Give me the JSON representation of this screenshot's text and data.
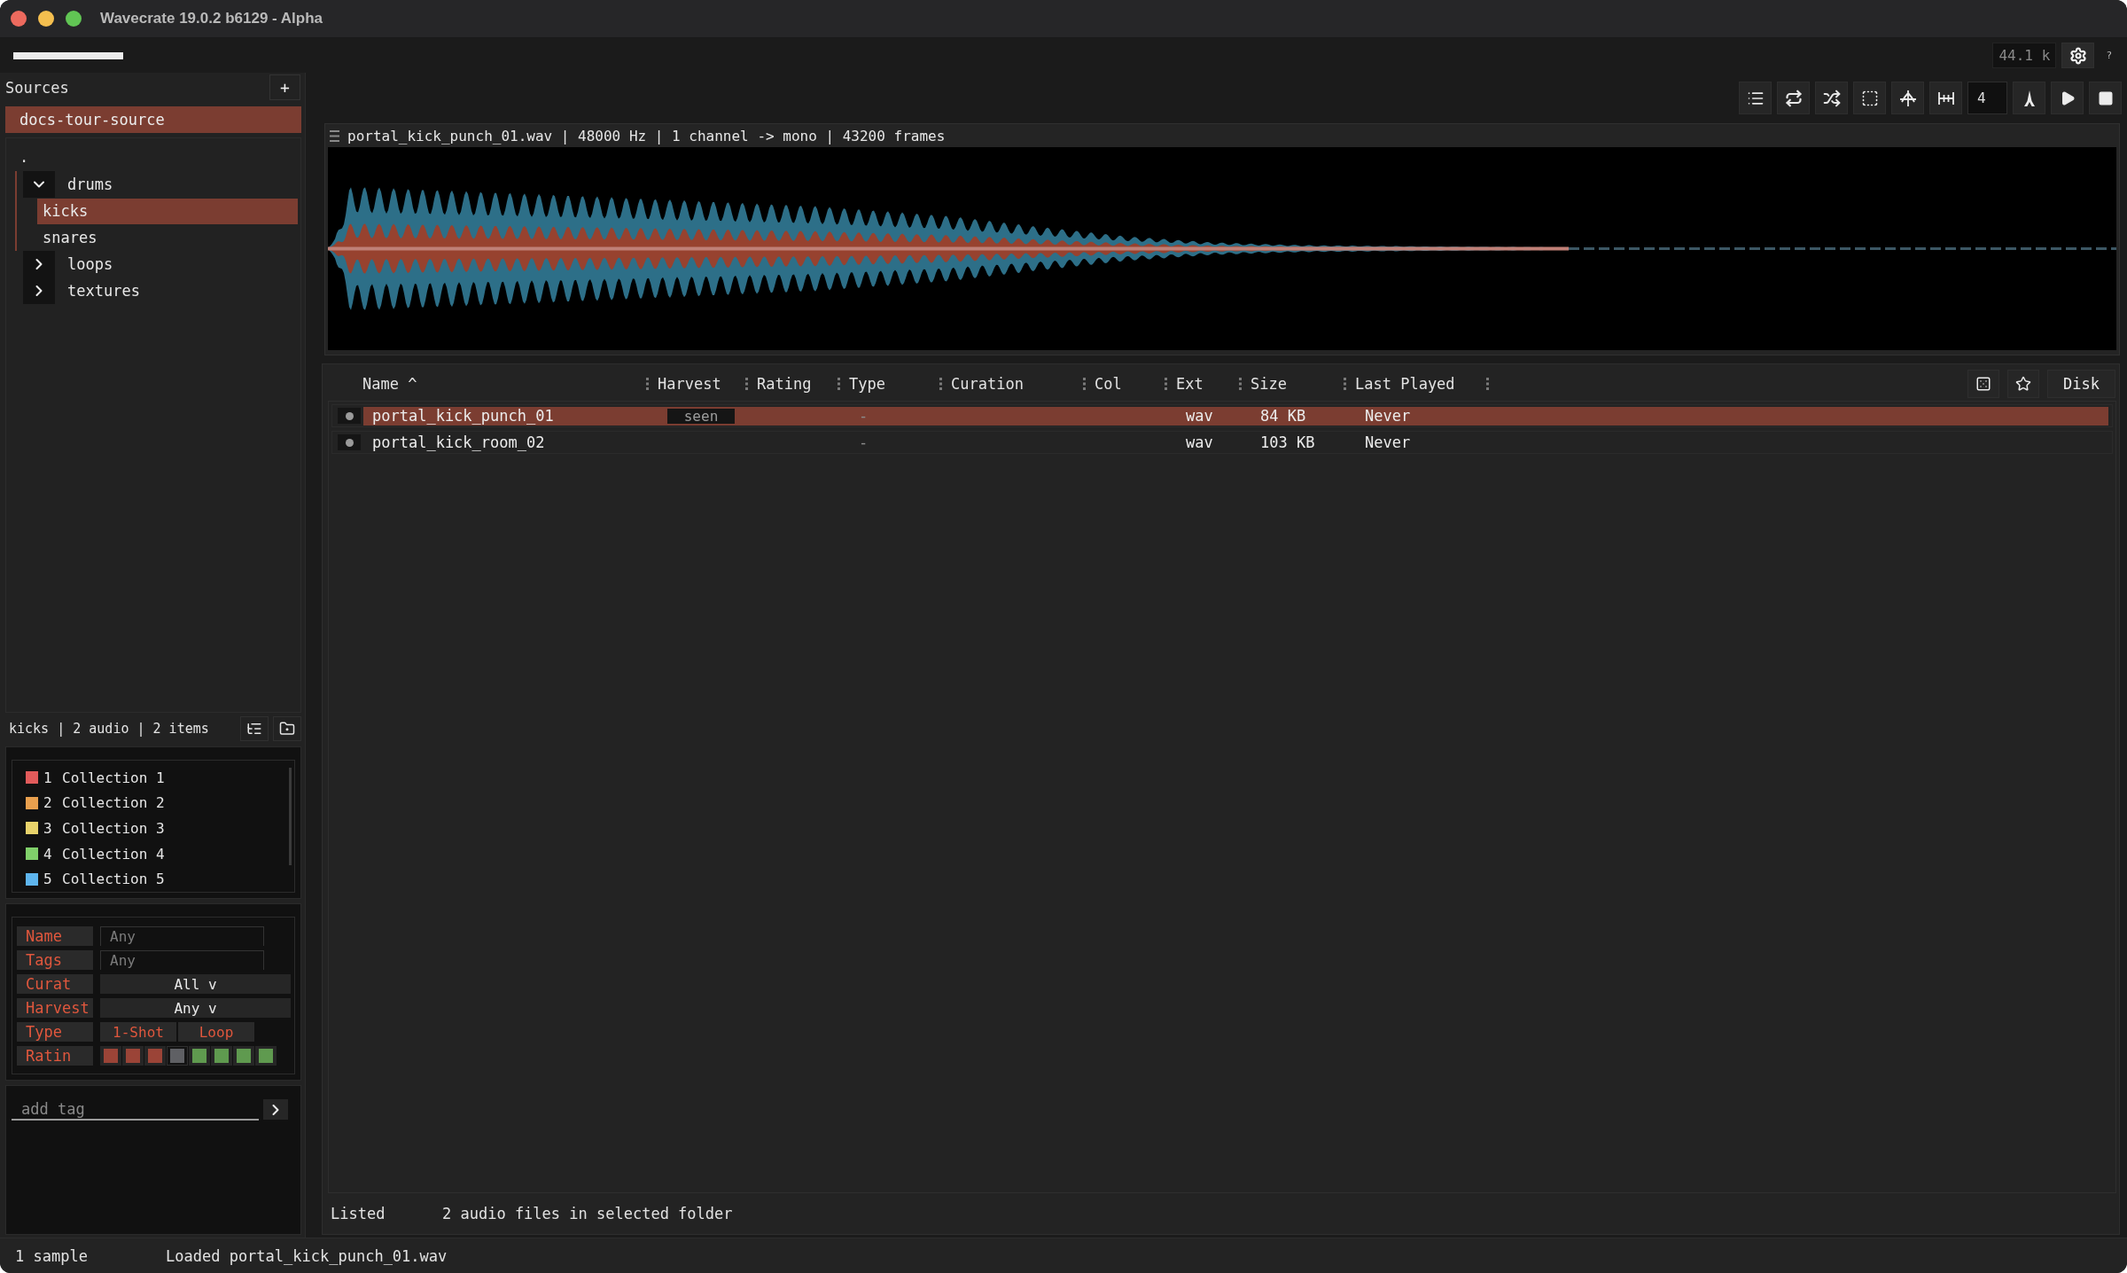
{
  "window": {
    "title": "Wavecrate 19.0.2 b6129 - Alpha"
  },
  "top_bar": {
    "sample_rate": "44.1 k",
    "help": "?"
  },
  "sources": {
    "title": "Sources",
    "add_label": "+",
    "items": [
      {
        "label": "docs-tour-source",
        "selected": true
      }
    ]
  },
  "folder_tree": {
    "root": ".",
    "children": [
      {
        "label": "drums",
        "expanded": true,
        "selected": false,
        "children": [
          {
            "label": "kicks",
            "selected": true
          },
          {
            "label": "snares",
            "selected": false
          }
        ]
      },
      {
        "label": "loops",
        "expanded": false,
        "selected": false
      },
      {
        "label": "textures",
        "expanded": false,
        "selected": false
      }
    ]
  },
  "folder_status": "kicks | 2 audio | 2 items",
  "collections": [
    {
      "number": "1",
      "label": "Collection 1",
      "color": "#e25b5b"
    },
    {
      "number": "2",
      "label": "Collection 2",
      "color": "#e9a04e"
    },
    {
      "number": "3",
      "label": "Collection 3",
      "color": "#e8d36b"
    },
    {
      "number": "4",
      "label": "Collection 4",
      "color": "#80d06a"
    },
    {
      "number": "5",
      "label": "Collection 5",
      "color": "#5eb5ee"
    }
  ],
  "filters": [
    {
      "kind": "text",
      "label": "Name",
      "placeholder": "Any"
    },
    {
      "kind": "text",
      "label": "Tags",
      "placeholder": "Any"
    },
    {
      "kind": "dropdown",
      "label": "Curat",
      "value": "All v"
    },
    {
      "kind": "dropdown",
      "label": "Harvest",
      "value": "Any v"
    },
    {
      "kind": "toggles",
      "label": "Type",
      "options": [
        "1-Shot",
        "Loop"
      ]
    },
    {
      "kind": "rating",
      "label": "Ratin",
      "cells": [
        {
          "color": "#9b4437",
          "selected": false
        },
        {
          "color": "#9b4437",
          "selected": false
        },
        {
          "color": "#9b4437",
          "selected": false
        },
        {
          "color": "#5f6064",
          "selected": true
        },
        {
          "color": "#5f9a4f",
          "selected": false
        },
        {
          "color": "#5f9a4f",
          "selected": false
        },
        {
          "color": "#5f9a4f",
          "selected": false
        },
        {
          "color": "#5f9a4f",
          "selected": false
        }
      ]
    }
  ],
  "tag_input": {
    "placeholder": "add tag"
  },
  "transport": {
    "bars_value": "4"
  },
  "waveform": {
    "header": "portal_kick_punch_01.wav | 48000 Hz | 1 channel -> mono | 43200 frames"
  },
  "table": {
    "columns": [
      "Name ^",
      "Harvest",
      "Rating",
      "Type",
      "Curation",
      "Col",
      "Ext",
      "Size",
      "Last Played"
    ],
    "disk_button": "Disk",
    "rows": [
      {
        "selected": true,
        "name": "portal_kick_punch_01",
        "harvest": "seen",
        "type": "-",
        "ext": "wav",
        "size": "84 KB",
        "last_played": "Never"
      },
      {
        "selected": false,
        "name": "portal_kick_room_02",
        "type": "-",
        "ext": "wav",
        "size": "103 KB",
        "last_played": "Never"
      }
    ],
    "footer": {
      "label": "Listed",
      "message": "2 audio files in selected folder"
    }
  },
  "status_bar": {
    "count": "1 sample",
    "message": "Loaded portal_kick_punch_01.wav"
  }
}
